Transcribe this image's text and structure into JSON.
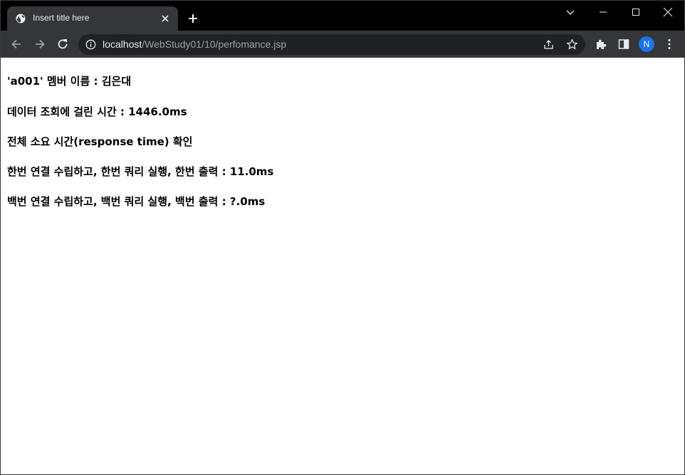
{
  "tab": {
    "title": "Insert title here"
  },
  "address_bar": {
    "host": "localhost",
    "path": "/WebStudy01/10/perfomance.jsp"
  },
  "profile": {
    "initial": "N"
  },
  "content": {
    "lines": [
      "'a001' 멤버 이름 : 김은대",
      "데이터 조회에 걸린 시간 : 1446.0ms",
      "전체 소요 시간(response time) 확인",
      "한번 연결 수립하고, 한번 쿼리 실행, 한번 출력 : 11.0ms",
      "백번 연결 수립하고, 백번 쿼리 실행, 백번 출력 : ?.0ms"
    ]
  },
  "colors": {
    "titlebar": "#000000",
    "toolbar": "#35363a",
    "omnibox": "#202124",
    "avatar": "#1a73e8"
  },
  "icons": [
    "globe-icon",
    "close-icon",
    "plus-icon",
    "chevron-down-icon",
    "minimize-icon",
    "maximize-icon",
    "window-close-icon",
    "back-icon",
    "forward-icon",
    "reload-icon",
    "info-icon",
    "share-icon",
    "star-icon",
    "extensions-icon",
    "side-panel-icon",
    "menu-icon"
  ]
}
